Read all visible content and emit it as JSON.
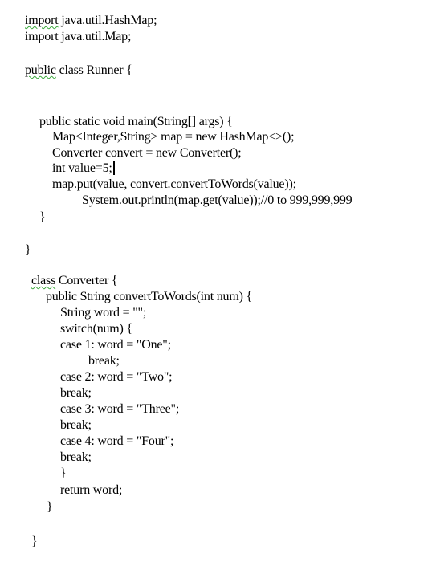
{
  "document": {
    "lines": [
      {
        "id": "import-hashmap",
        "prefix": "import",
        "text": " java.util.HashMap;"
      },
      {
        "id": "import-map",
        "prefix": "",
        "text": "import java.util.Map;"
      },
      {
        "id": "class-runner",
        "prefix": "public",
        "text": " class Runner {"
      },
      {
        "id": "main-sig",
        "prefix": "",
        "text": "public static void main(String[] args) {"
      },
      {
        "id": "map-decl",
        "prefix": "",
        "text": "Map<Integer,String> map = new HashMap<>();"
      },
      {
        "id": "converter-decl",
        "prefix": "",
        "text": "Converter convert = new Converter();"
      },
      {
        "id": "value-decl",
        "prefix": "",
        "text": "int value=5;"
      },
      {
        "id": "map-put",
        "prefix": "",
        "text": "map.put(value, convert.convertToWords(value));"
      },
      {
        "id": "println",
        "prefix": "",
        "text": "System.out.println(map.get(value));//0 to 999,999,999"
      },
      {
        "id": "main-close",
        "prefix": "",
        "text": "}"
      },
      {
        "id": "runner-close",
        "prefix": "",
        "text": "}"
      },
      {
        "id": "class-converter",
        "prefix": "class",
        "text": " Converter {"
      },
      {
        "id": "convert-sig",
        "prefix": "",
        "text": "public String convertToWords(int num) {"
      },
      {
        "id": "word-decl",
        "prefix": "",
        "text": "String word = \"\";"
      },
      {
        "id": "switch",
        "prefix": "",
        "text": "switch(num) {"
      },
      {
        "id": "case1",
        "prefix": "",
        "text": "case 1: word = \"One\";"
      },
      {
        "id": "break1",
        "prefix": "",
        "text": "break;"
      },
      {
        "id": "case2",
        "prefix": "",
        "text": "case 2: word = \"Two\";"
      },
      {
        "id": "break2",
        "prefix": "",
        "text": "break;"
      },
      {
        "id": "case3",
        "prefix": "",
        "text": "case 3: word = \"Three\";"
      },
      {
        "id": "break3",
        "prefix": "",
        "text": "break;"
      },
      {
        "id": "case4",
        "prefix": "",
        "text": "case 4: word = \"Four\";"
      },
      {
        "id": "break4",
        "prefix": "",
        "text": "break;"
      },
      {
        "id": "switch-close",
        "prefix": "",
        "text": "}"
      },
      {
        "id": "return",
        "prefix": "",
        "text": "return word;"
      },
      {
        "id": "method-close",
        "prefix": "",
        "text": "}"
      },
      {
        "id": "converter-close",
        "prefix": "",
        "text": "}"
      }
    ]
  },
  "colors": {
    "text": "#000000",
    "spellcheck_squiggle": "#3aa83a",
    "background": "#ffffff"
  }
}
